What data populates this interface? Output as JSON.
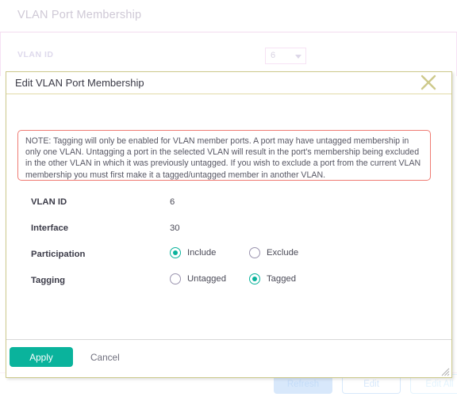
{
  "background_page": {
    "title": "VLAN Port Membership",
    "field_label": "VLAN ID",
    "select_value": "6",
    "buttons": {
      "refresh": "Refresh",
      "edit": "Edit",
      "edit_all": "Edit All"
    }
  },
  "dialog": {
    "title": "Edit VLAN Port Membership",
    "close_icon": "close-icon",
    "note": "NOTE: Tagging will only be enabled for VLAN member ports. A port may have untagged membership in only one VLAN. Untagging a port in the selected VLAN will result in the port's membership being excluded in the other VLAN in which it was previously untagged. If you wish to exclude a port from the current VLAN membership you must first make it a tagged/untagged member in another VLAN.",
    "fields": {
      "vlan_id": {
        "label": "VLAN ID",
        "value": "6"
      },
      "interface": {
        "label": "Interface",
        "value": "30"
      },
      "participation": {
        "label": "Participation",
        "options": [
          {
            "label": "Include",
            "selected": true
          },
          {
            "label": "Exclude",
            "selected": false
          }
        ]
      },
      "tagging": {
        "label": "Tagging",
        "options": [
          {
            "label": "Untagged",
            "selected": false
          },
          {
            "label": "Tagged",
            "selected": true
          }
        ]
      }
    },
    "footer": {
      "apply": "Apply",
      "cancel": "Cancel"
    }
  },
  "colors": {
    "accent_teal": "#0ab39c",
    "note_border": "#ef7b73",
    "dialog_border": "#cdc98b",
    "bg_accent_pink": "#f6e2f4",
    "radio_off": "#9a93ae"
  }
}
